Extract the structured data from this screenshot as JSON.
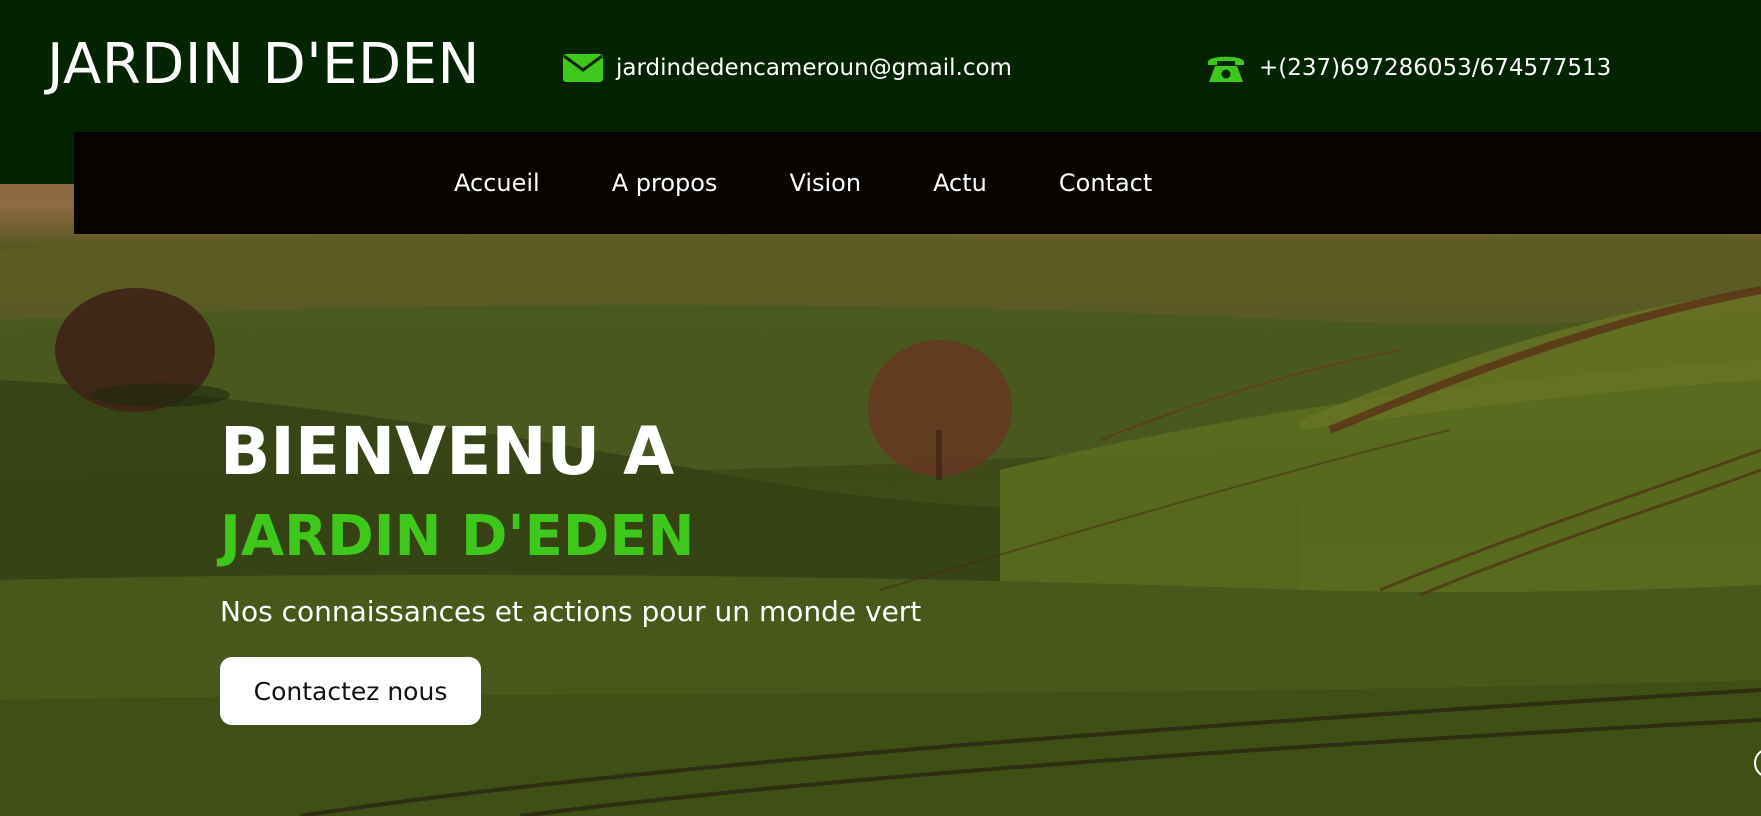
{
  "header": {
    "brand": "JARDIN D'EDEN",
    "email": {
      "icon": "envelope-icon",
      "text": "jardindedencameroun@gmail.com"
    },
    "phone": {
      "icon": "phone-icon",
      "text": "+(237)697286053/674577513"
    }
  },
  "nav": {
    "items": [
      {
        "label": "Accueil"
      },
      {
        "label": "A propos"
      },
      {
        "label": "Vision"
      },
      {
        "label": "Actu"
      },
      {
        "label": "Contact"
      }
    ]
  },
  "hero": {
    "title_line1": "BIENVENU A",
    "title_line2": "JARDIN D'EDEN",
    "subtitle": "Nos connaissances et actions pour un monde vert",
    "cta_label": "Contactez nous"
  },
  "colors": {
    "topbar_bg": "#042300",
    "navbar_bg": "#060300",
    "accent_green": "#3ec81c",
    "text_white": "#ffffff"
  }
}
